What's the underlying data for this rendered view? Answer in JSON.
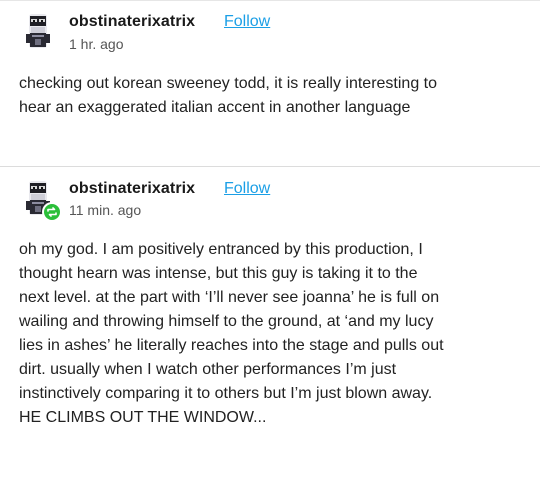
{
  "posts": [
    {
      "username": "obstinaterixatrix",
      "follow_label": "Follow",
      "time": "1 hr. ago",
      "body_lines": [
        "checking out korean sweeney todd, it is really interesting to",
        "hear an exaggerated italian accent in another language"
      ]
    },
    {
      "username": "obstinaterixatrix",
      "follow_label": "Follow",
      "time": "11 min. ago",
      "body_lines": [
        "oh my god. I am positively entranced by this production, I",
        "thought hearn was intense, but this guy is taking it to the",
        "next level. at the part with ‘I’ll never see joanna’ he is full on",
        "wailing and throwing himself to the ground, at ‘and my lucy",
        "lies in ashes’ he literally reaches into the stage and pulls out",
        "dirt. usually when I watch other performances I’m just",
        "instinctively comparing it to others but I’m just blown away.",
        "HE CLIMBS OUT THE WINDOW..."
      ]
    }
  ],
  "icons": {
    "avatar": "pixel-character-avatar-icon",
    "reblog": "reblog-icon"
  },
  "colors": {
    "follow_link": "#1b9fe6",
    "reblog_badge": "#2bbf3a",
    "separator": "#dcdcdc"
  }
}
